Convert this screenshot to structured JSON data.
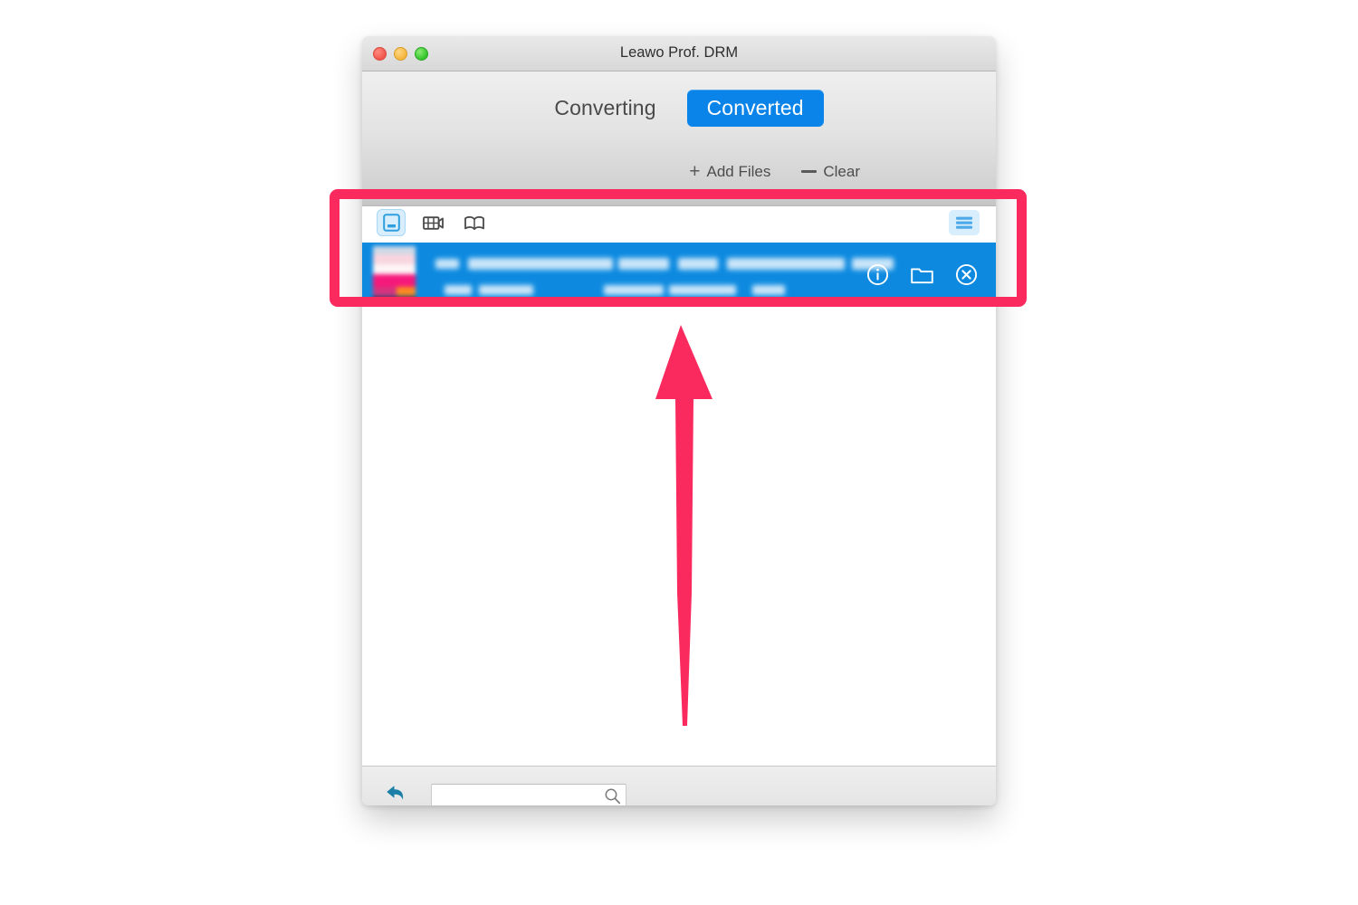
{
  "window": {
    "title": "Leawo Prof. DRM",
    "traffic_lights": [
      "close-button",
      "minimize-button",
      "maximize-button"
    ]
  },
  "tabs": [
    {
      "label": "Converting",
      "active": false
    },
    {
      "label": "Converted",
      "active": true
    }
  ],
  "top_actions": [
    {
      "label": "Add Files",
      "icon": "plus-icon"
    },
    {
      "label": "Clear",
      "icon": "minus-icon"
    }
  ],
  "icon_toolbar": {
    "left_icons": [
      {
        "name": "media-library-icon",
        "selected": true
      },
      {
        "name": "video-film-icon",
        "selected": false
      },
      {
        "name": "book-icon",
        "selected": false
      }
    ],
    "right_icon": {
      "name": "list-view-icon",
      "selected": true
    }
  },
  "file_list": {
    "rows": [
      {
        "selected": true,
        "thumbnail": "movie-poster-thumbnail",
        "title_blurred": true,
        "subtitle_blurred": true,
        "actions": [
          {
            "name": "info-icon",
            "label": "Info"
          },
          {
            "name": "folder-icon",
            "label": "Open folder"
          },
          {
            "name": "remove-icon",
            "label": "Remove"
          }
        ]
      }
    ]
  },
  "bottom_bar": {
    "back_icon": "back-arrow-icon",
    "search": {
      "value": "",
      "placeholder": "",
      "icon": "search-icon"
    }
  },
  "annotations": {
    "highlight_color": "#fa2a5e",
    "highlight_rect": "selected-file-row-highlight",
    "arrow": "upward-pointer-arrow"
  },
  "colors": {
    "accent_blue": "#0a84e8",
    "row_blue": "#0d8ae0",
    "annotation_pink": "#fa2a5e"
  }
}
